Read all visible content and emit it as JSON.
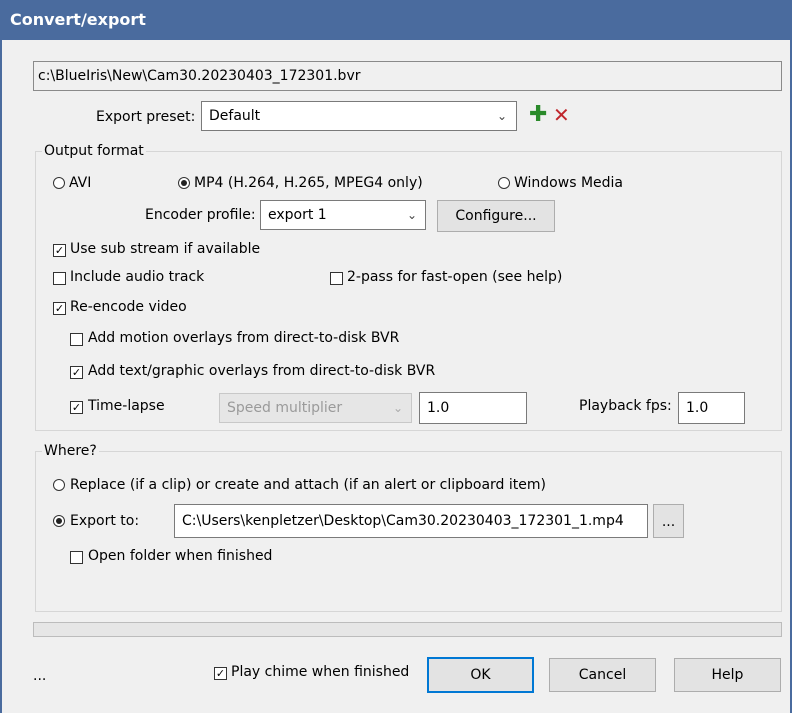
{
  "window": {
    "title": "Convert/export"
  },
  "source_path": "c:\\BlueIris\\New\\Cam30.20230403_172301.bvr",
  "preset": {
    "label": "Export preset:",
    "value": "Default",
    "add_icon": "plus-icon",
    "delete_icon": "delete-x-icon"
  },
  "output_format": {
    "title": "Output format",
    "avi_label": "AVI",
    "mp4_label": "MP4 (H.264, H.265, MPEG4 only)",
    "wm_label": "Windows Media",
    "selected": "mp4",
    "encoder_label": "Encoder profile:",
    "encoder_value": "export 1",
    "configure_label": "Configure...",
    "sub_stream_label": "Use sub stream if available",
    "sub_stream_checked": true,
    "audio_label": "Include audio track",
    "audio_checked": false,
    "twopass_label": "2-pass for fast-open (see help)",
    "twopass_checked": false,
    "reencode_label": "Re-encode video",
    "reencode_checked": true,
    "motion_label": "Add motion overlays from direct-to-disk BVR",
    "motion_checked": false,
    "text_label": "Add text/graphic overlays from direct-to-disk BVR",
    "text_checked": true,
    "timelapse_label": "Time-lapse",
    "timelapse_checked": true,
    "speed_value": "Speed multiplier",
    "speed_input": "1.0",
    "fps_label": "Playback fps:",
    "fps_value": "1.0"
  },
  "where": {
    "title": "Where?",
    "replace_label": "Replace (if a clip) or create and attach (if an alert or clipboard item)",
    "export_label": "Export to:",
    "selected": "export",
    "export_path": "C:\\Users\\kenpletzer\\Desktop\\Cam30.20230403_172301_1.mp4",
    "browse_label": "...",
    "open_folder_label": "Open folder when finished",
    "open_folder_checked": false
  },
  "footer": {
    "ellipsis": "...",
    "chime_label": "Play chime when finished",
    "chime_checked": true,
    "ok": "OK",
    "cancel": "Cancel",
    "help": "Help"
  },
  "colors": {
    "titlebar": "#4a6b9e",
    "accent": "#0078d4",
    "add_green": "#2a8a2a",
    "delete_red": "#c0262c"
  }
}
